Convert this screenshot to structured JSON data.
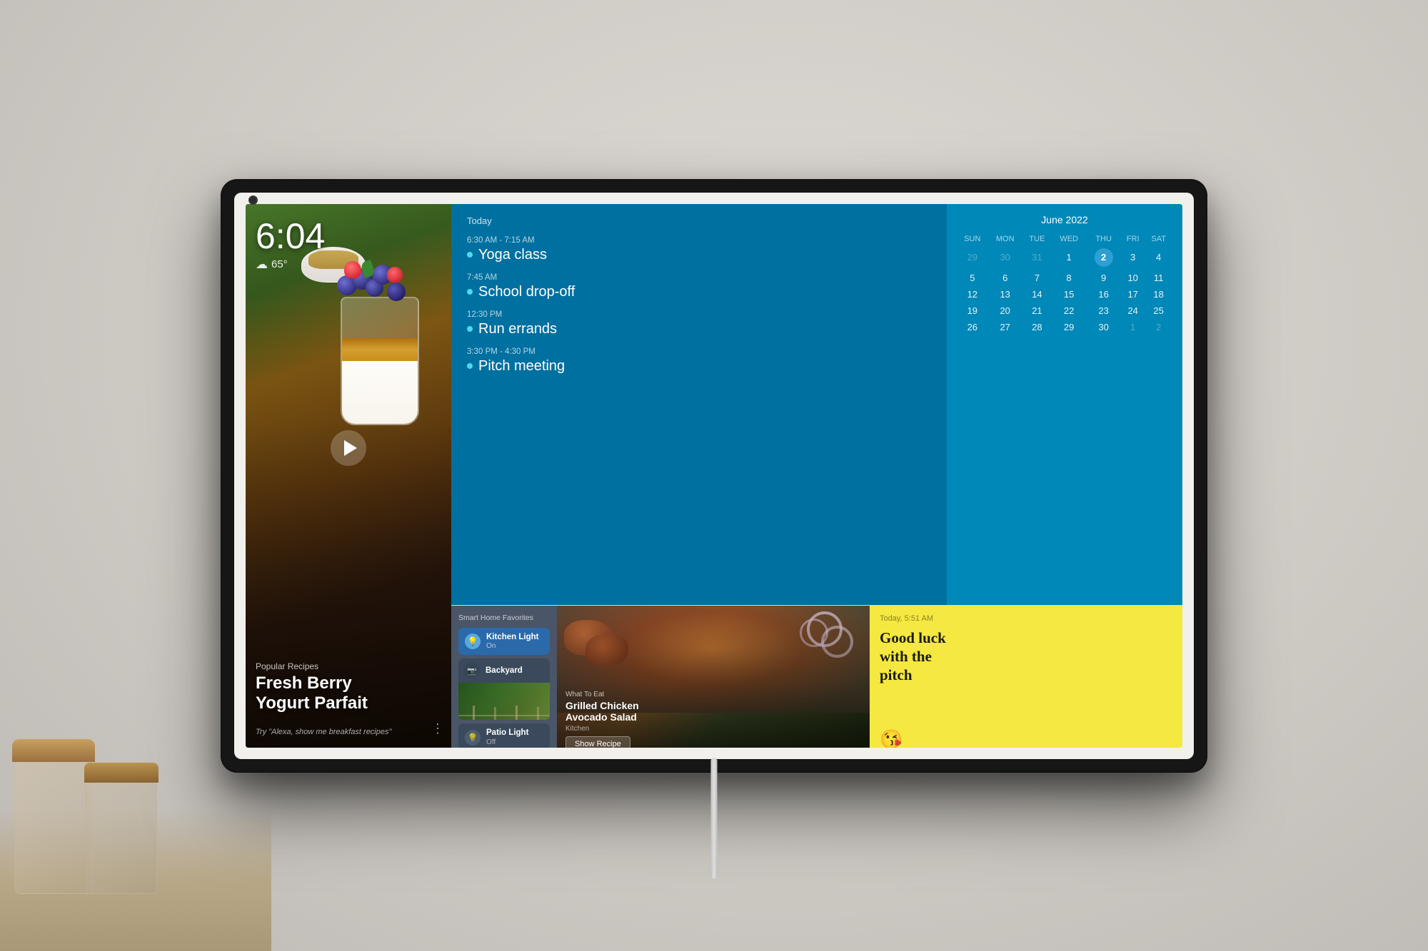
{
  "device": {
    "camera_label": "camera"
  },
  "clock": {
    "time": "6:04",
    "weather_icon": "☁",
    "temperature": "65°"
  },
  "recipe": {
    "category": "Popular Recipes",
    "title": "Fresh Berry\nYogurt Parfait",
    "hint": "Try \"Alexa, show me breakfast recipes\""
  },
  "calendar": {
    "title": "June 2022",
    "days_of_week": [
      "SUN",
      "MON",
      "TUE",
      "WED",
      "THU",
      "FRI",
      "SAT"
    ],
    "weeks": [
      [
        {
          "n": "29",
          "cls": "prev-month"
        },
        {
          "n": "30",
          "cls": "prev-month"
        },
        {
          "n": "31",
          "cls": "prev-month"
        },
        {
          "n": "1",
          "cls": ""
        },
        {
          "n": "2",
          "cls": "today"
        },
        {
          "n": "3",
          "cls": ""
        },
        {
          "n": "4",
          "cls": ""
        }
      ],
      [
        {
          "n": "5",
          "cls": ""
        },
        {
          "n": "6",
          "cls": ""
        },
        {
          "n": "7",
          "cls": ""
        },
        {
          "n": "8",
          "cls": ""
        },
        {
          "n": "9",
          "cls": ""
        },
        {
          "n": "10",
          "cls": ""
        },
        {
          "n": "11",
          "cls": ""
        }
      ],
      [
        {
          "n": "12",
          "cls": ""
        },
        {
          "n": "13",
          "cls": ""
        },
        {
          "n": "14",
          "cls": ""
        },
        {
          "n": "15",
          "cls": ""
        },
        {
          "n": "16",
          "cls": ""
        },
        {
          "n": "17",
          "cls": ""
        },
        {
          "n": "18",
          "cls": ""
        }
      ],
      [
        {
          "n": "19",
          "cls": ""
        },
        {
          "n": "20",
          "cls": ""
        },
        {
          "n": "21",
          "cls": ""
        },
        {
          "n": "22",
          "cls": ""
        },
        {
          "n": "23",
          "cls": ""
        },
        {
          "n": "24",
          "cls": ""
        },
        {
          "n": "25",
          "cls": ""
        }
      ],
      [
        {
          "n": "26",
          "cls": ""
        },
        {
          "n": "27",
          "cls": ""
        },
        {
          "n": "28",
          "cls": ""
        },
        {
          "n": "29",
          "cls": ""
        },
        {
          "n": "30",
          "cls": ""
        },
        {
          "n": "1",
          "cls": "next-month"
        },
        {
          "n": "2",
          "cls": "next-month"
        }
      ]
    ]
  },
  "events": {
    "today_label": "Today",
    "items": [
      {
        "time": "6:30 AM - 7:15 AM",
        "name": "Yoga class"
      },
      {
        "time": "7:45 AM",
        "name": "School drop-off"
      },
      {
        "time": "12:30 PM",
        "name": "Run errands"
      },
      {
        "time": "3:30 PM - 4:30 PM",
        "name": "Pitch meeting"
      }
    ]
  },
  "smart_home": {
    "title": "Smart Home Favorites",
    "devices": [
      {
        "name": "Kitchen Light",
        "status": "On",
        "type": "light-on"
      },
      {
        "name": "Backyard",
        "status": "",
        "type": "cam"
      },
      {
        "name": "Patio Light",
        "status": "Off",
        "type": "light-off"
      }
    ]
  },
  "what_to_eat": {
    "tag": "What To Eat",
    "title": "Grilled Chicken\nAvocado Salad",
    "source": "Kitchen",
    "show_recipe_btn": "Show Recipe"
  },
  "note": {
    "timestamp": "Today, 5:51 AM",
    "text": "Good luck\nwith the\npitch",
    "emoji": "😘"
  }
}
